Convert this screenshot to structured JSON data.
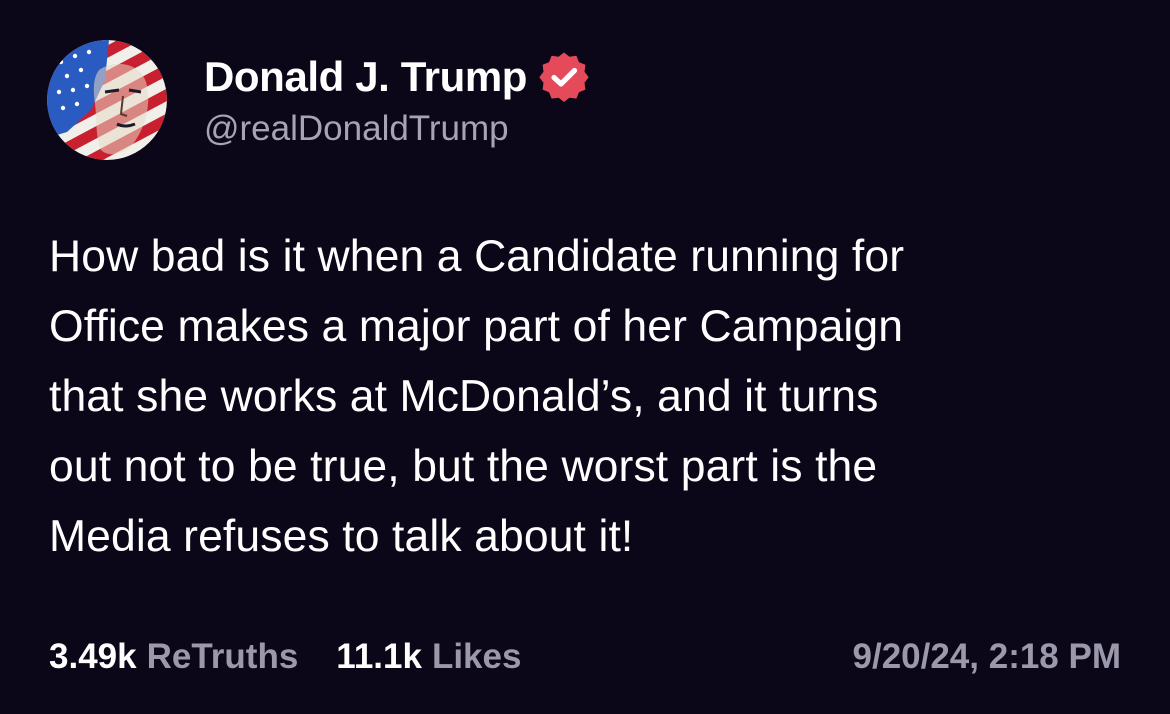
{
  "post": {
    "author": {
      "display_name": "Donald J. Trump",
      "handle": "@realDonaldTrump",
      "verified_icon": "verified-badge-icon",
      "verified_color": "#e54a5a"
    },
    "text": "How bad is it when a Candidate running for\nOffice makes a major part of her Campaign\nthat she works at McDonald’s, and it turns\nout not to be true, but the worst part is the\nMedia refuses to talk about it!",
    "stats": {
      "retruths_count": "3.49k",
      "retruths_label": "ReTruths",
      "likes_count": "11.1k",
      "likes_label": "Likes"
    },
    "timestamp": "9/20/24, 2:18 PM"
  },
  "colors": {
    "background": "#0b0718",
    "primary_text": "#ffffff",
    "secondary_text": "#9b98ac"
  }
}
